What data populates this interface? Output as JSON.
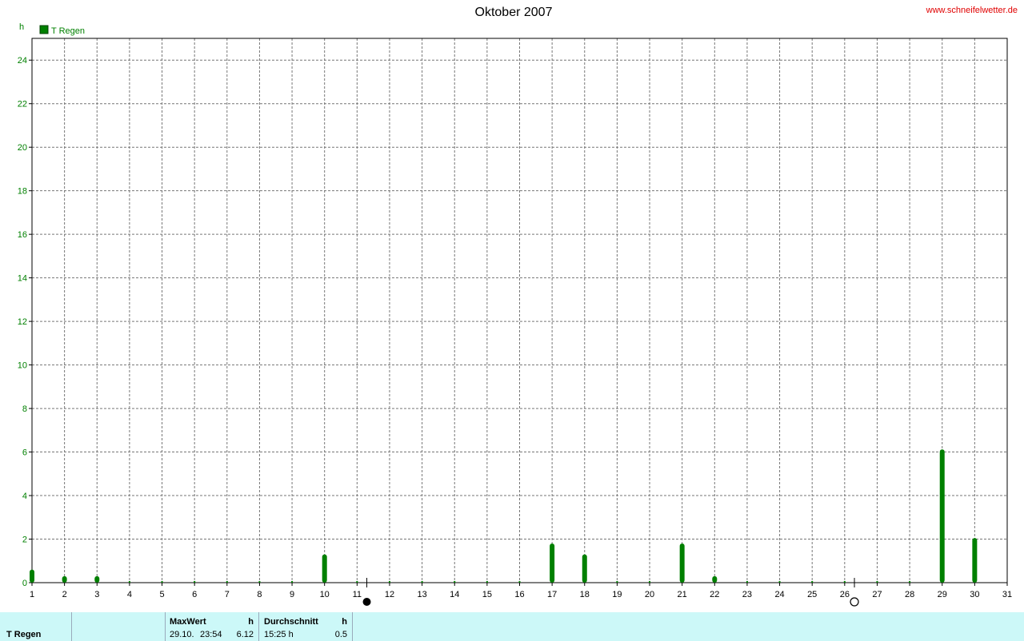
{
  "header": {
    "title": "Oktober 2007",
    "site": "www.schneifelwetter.de",
    "unit": "h"
  },
  "chart_data": {
    "type": "bar",
    "title": "Oktober 2007",
    "ylabel": "h",
    "ylim": [
      0,
      25
    ],
    "yticks": [
      0,
      2,
      4,
      6,
      8,
      10,
      12,
      14,
      16,
      18,
      20,
      22,
      24
    ],
    "xlim": [
      1,
      31
    ],
    "xticks": [
      1,
      2,
      3,
      4,
      5,
      6,
      7,
      8,
      9,
      10,
      11,
      12,
      13,
      14,
      15,
      16,
      17,
      18,
      19,
      20,
      21,
      22,
      23,
      24,
      25,
      26,
      27,
      28,
      29,
      30,
      31
    ],
    "grid": true,
    "legend_position": "top-left",
    "series": [
      {
        "name": "T Regen",
        "color": "#008000",
        "x": [
          1,
          2,
          3,
          4,
          5,
          6,
          7,
          8,
          9,
          10,
          11,
          12,
          13,
          14,
          15,
          16,
          17,
          18,
          19,
          20,
          21,
          22,
          23,
          24,
          25,
          26,
          27,
          28,
          29,
          30
        ],
        "values": [
          0.6,
          0.3,
          0.3,
          0,
          0,
          0,
          0,
          0,
          0,
          1.3,
          0,
          0,
          0,
          0,
          0,
          0,
          1.8,
          1.3,
          0,
          0,
          1.8,
          0.3,
          0,
          0,
          0,
          0,
          0,
          0,
          6.12,
          2.05
        ]
      }
    ],
    "moon_phases": [
      {
        "x": 11.3,
        "phase": "new-moon"
      },
      {
        "x": 26.3,
        "phase": "full-moon"
      }
    ]
  },
  "stats": {
    "series_label": "T Regen",
    "max_header": "MaxWert",
    "max_unit": "h",
    "max_date": "29.10.",
    "max_time": "23:54",
    "max_value": "6.12",
    "avg_header": "Durchschnitt",
    "avg_unit": "h",
    "avg_time": "15:25 h",
    "avg_value": "0.5"
  }
}
